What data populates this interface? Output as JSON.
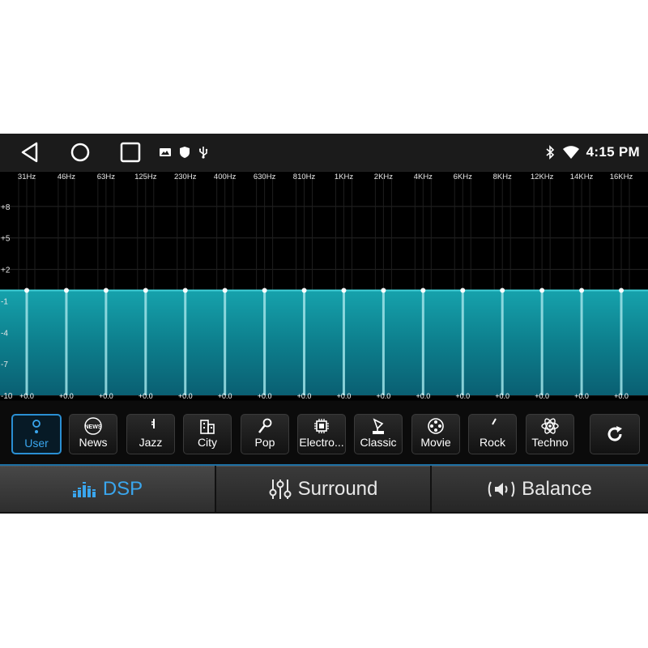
{
  "status_bar": {
    "time": "4:15 PM",
    "nav": [
      "back",
      "home",
      "recents"
    ],
    "notification_icons": [
      "image-icon",
      "shield-icon",
      "usb-icon"
    ],
    "system_icons": [
      "bluetooth-icon",
      "wifi-icon"
    ]
  },
  "equalizer": {
    "bands": [
      {
        "freq": "31Hz",
        "gain": "+0.0",
        "value": 0
      },
      {
        "freq": "46Hz",
        "gain": "+0.0",
        "value": 0
      },
      {
        "freq": "63Hz",
        "gain": "+0.0",
        "value": 0
      },
      {
        "freq": "125Hz",
        "gain": "+0.0",
        "value": 0
      },
      {
        "freq": "230Hz",
        "gain": "+0.0",
        "value": 0
      },
      {
        "freq": "400Hz",
        "gain": "+0.0",
        "value": 0
      },
      {
        "freq": "630Hz",
        "gain": "+0.0",
        "value": 0
      },
      {
        "freq": "810Hz",
        "gain": "+0.0",
        "value": 0
      },
      {
        "freq": "1KHz",
        "gain": "+0.0",
        "value": 0
      },
      {
        "freq": "2KHz",
        "gain": "+0.0",
        "value": 0
      },
      {
        "freq": "4KHz",
        "gain": "+0.0",
        "value": 0
      },
      {
        "freq": "6KHz",
        "gain": "+0.0",
        "value": 0
      },
      {
        "freq": "8KHz",
        "gain": "+0.0",
        "value": 0
      },
      {
        "freq": "12KHz",
        "gain": "+0.0",
        "value": 0
      },
      {
        "freq": "14KHz",
        "gain": "+0.0",
        "value": 0
      },
      {
        "freq": "16KHz",
        "gain": "+0.0",
        "value": 0
      }
    ],
    "y_labels": [
      {
        "label": "+8",
        "value": 8
      },
      {
        "label": "+5",
        "value": 5
      },
      {
        "label": "+2",
        "value": 2
      },
      {
        "label": "-1",
        "value": -1
      },
      {
        "label": "-4",
        "value": -4
      },
      {
        "label": "-7",
        "value": -7
      },
      {
        "label": "-10",
        "value": -10
      }
    ],
    "range": [
      -10,
      11
    ],
    "fill_color": "#0f8c96",
    "slider_color": "#9fe3e8"
  },
  "presets": [
    {
      "label": "User",
      "icon": "user-icon",
      "active": true
    },
    {
      "label": "News",
      "icon": "news-icon",
      "active": false
    },
    {
      "label": "Jazz",
      "icon": "saxophone-icon",
      "active": false
    },
    {
      "label": "City",
      "icon": "building-icon",
      "active": false
    },
    {
      "label": "Pop",
      "icon": "microphone-icon",
      "active": false
    },
    {
      "label": "Electro...",
      "icon": "chip-icon",
      "active": false
    },
    {
      "label": "Classic",
      "icon": "gramophone-icon",
      "active": false
    },
    {
      "label": "Movie",
      "icon": "film-reel-icon",
      "active": false
    },
    {
      "label": "Rock",
      "icon": "guitar-icon",
      "active": false
    },
    {
      "label": "Techno",
      "icon": "atom-icon",
      "active": false
    }
  ],
  "reset": {
    "icon": "refresh-icon"
  },
  "tabs": [
    {
      "label": "DSP",
      "icon": "equalizer-bars-icon",
      "active": true
    },
    {
      "label": "Surround",
      "icon": "sliders-icon",
      "active": false
    },
    {
      "label": "Balance",
      "icon": "speaker-icon",
      "active": false
    }
  ],
  "colors": {
    "accent": "#3aa6ee",
    "teal": "#0f8c96"
  }
}
